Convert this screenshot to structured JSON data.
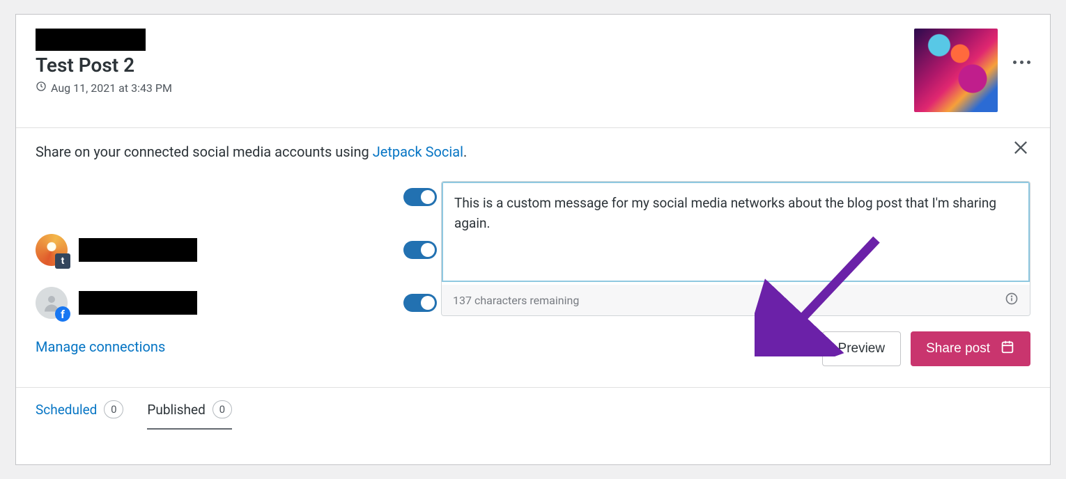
{
  "header": {
    "post_title": "Test Post 2",
    "timestamp": "Aug 11, 2021 at 3:43 PM"
  },
  "share": {
    "intro_prefix": "Share on your connected social media accounts using ",
    "link_text": "Jetpack Social",
    "intro_suffix": ".",
    "manage_link": "Manage connections",
    "connections": [
      {
        "network": "tumblr",
        "toggle_on": true
      },
      {
        "network": "facebook",
        "toggle_on": true
      }
    ],
    "master_toggle_on": true,
    "message_value": "This is a custom message for my social media networks about the blog post that I'm sharing again.",
    "chars_remaining": "137 characters remaining",
    "preview_label": "Preview",
    "share_label": "Share post"
  },
  "tabs": {
    "scheduled_label": "Scheduled",
    "scheduled_count": "0",
    "published_label": "Published",
    "published_count": "0"
  },
  "colors": {
    "link": "#0675c4",
    "primary_action": "#c9356e",
    "toggle_on": "#2271b1",
    "annotation_arrow": "#6b21a8"
  }
}
